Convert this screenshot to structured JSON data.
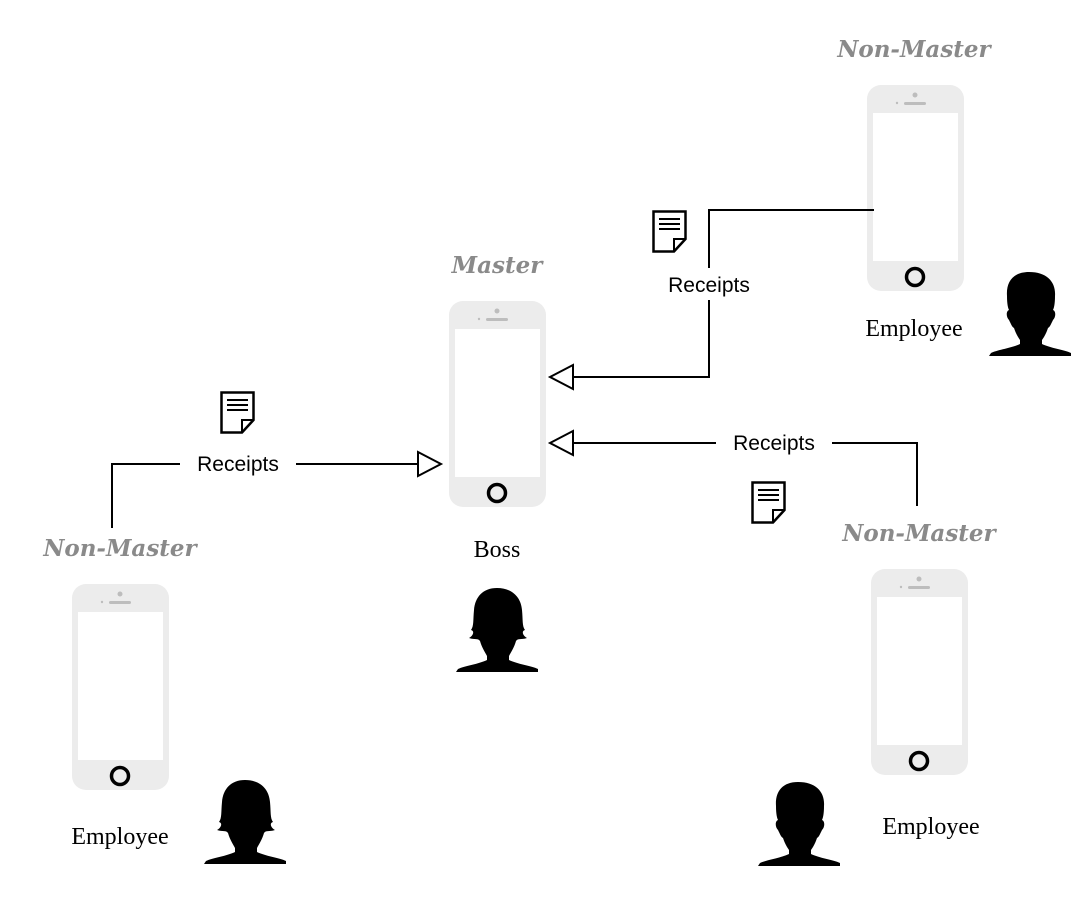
{
  "devices": [
    {
      "id": "boss",
      "role_label": "Master",
      "person_label": "Boss",
      "person_type": "female-silhouette"
    },
    {
      "id": "employee-top-right",
      "role_label": "Non-Master",
      "person_label": "Employee",
      "person_type": "male-silhouette"
    },
    {
      "id": "employee-left",
      "role_label": "Non-Master",
      "person_label": "Employee",
      "person_type": "female-silhouette"
    },
    {
      "id": "employee-bottom-right",
      "role_label": "Non-Master",
      "person_label": "Employee",
      "person_type": "male-silhouette"
    }
  ],
  "connections": [
    {
      "from": "employee-top-right",
      "to": "boss",
      "label": "Receipts",
      "icon": "document-icon"
    },
    {
      "from": "employee-left",
      "to": "boss",
      "label": "Receipts",
      "icon": "document-icon"
    },
    {
      "from": "employee-bottom-right",
      "to": "boss",
      "label": "Receipts",
      "icon": "document-icon"
    }
  ],
  "colors": {
    "role_label": "#8a8a8a",
    "phone": "#ececec",
    "line": "#000000"
  }
}
